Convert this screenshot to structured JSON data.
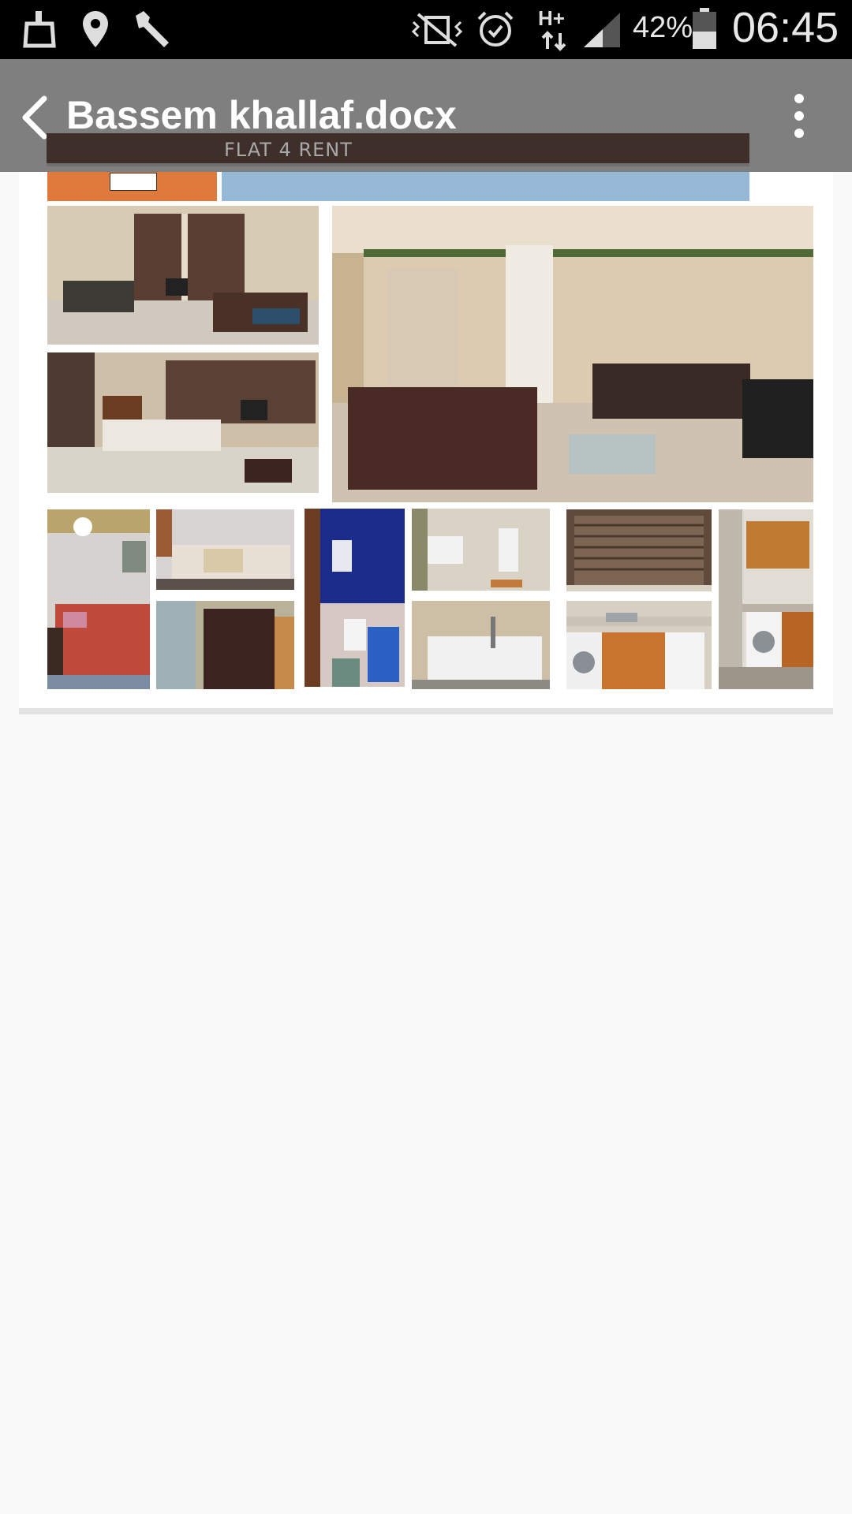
{
  "status_bar": {
    "battery_percent": "42%",
    "time": "06:45",
    "network_type": "H+",
    "icons": [
      "cleaner-icon",
      "location-icon",
      "wrench-icon",
      "vibrate-off-icon",
      "alarm-icon",
      "data-transfer-icon",
      "signal-icon",
      "battery-icon"
    ]
  },
  "app_bar": {
    "title": "Bassem khallaf.docx",
    "back_icon": "chevron-left-icon",
    "menu_icon": "more-vertical-icon"
  },
  "document": {
    "banner_text": "FLAT 4 RENT",
    "colors": {
      "banner": "#3e2f2b",
      "orange_bar": "#e07a3c",
      "blue_bar": "#96b8d7"
    },
    "photos": [
      "living-room-photo",
      "dining-room-photo",
      "lounge-panorama-photo",
      "bedroom-photo",
      "twin-bedroom-photo",
      "wardrobe-photo",
      "blue-bathroom-photo",
      "toilet-photo",
      "bathtub-photo",
      "window-blinds-photo",
      "kitchen-counter-photo",
      "kitchen-corner-photo"
    ]
  }
}
